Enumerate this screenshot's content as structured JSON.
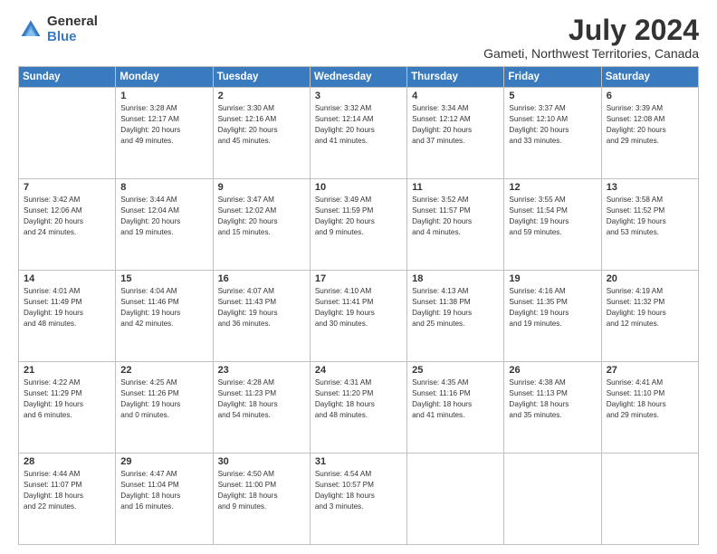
{
  "header": {
    "logo_general": "General",
    "logo_blue": "Blue",
    "month_year": "July 2024",
    "location": "Gameti, Northwest Territories, Canada"
  },
  "days_of_week": [
    "Sunday",
    "Monday",
    "Tuesday",
    "Wednesday",
    "Thursday",
    "Friday",
    "Saturday"
  ],
  "weeks": [
    [
      {
        "day": "",
        "info": ""
      },
      {
        "day": "1",
        "info": "Sunrise: 3:28 AM\nSunset: 12:17 AM\nDaylight: 20 hours\nand 49 minutes."
      },
      {
        "day": "2",
        "info": "Sunrise: 3:30 AM\nSunset: 12:16 AM\nDaylight: 20 hours\nand 45 minutes."
      },
      {
        "day": "3",
        "info": "Sunrise: 3:32 AM\nSunset: 12:14 AM\nDaylight: 20 hours\nand 41 minutes."
      },
      {
        "day": "4",
        "info": "Sunrise: 3:34 AM\nSunset: 12:12 AM\nDaylight: 20 hours\nand 37 minutes."
      },
      {
        "day": "5",
        "info": "Sunrise: 3:37 AM\nSunset: 12:10 AM\nDaylight: 20 hours\nand 33 minutes."
      },
      {
        "day": "6",
        "info": "Sunrise: 3:39 AM\nSunset: 12:08 AM\nDaylight: 20 hours\nand 29 minutes."
      }
    ],
    [
      {
        "day": "7",
        "info": "Sunrise: 3:42 AM\nSunset: 12:06 AM\nDaylight: 20 hours\nand 24 minutes."
      },
      {
        "day": "8",
        "info": "Sunrise: 3:44 AM\nSunset: 12:04 AM\nDaylight: 20 hours\nand 19 minutes."
      },
      {
        "day": "9",
        "info": "Sunrise: 3:47 AM\nSunset: 12:02 AM\nDaylight: 20 hours\nand 15 minutes."
      },
      {
        "day": "10",
        "info": "Sunrise: 3:49 AM\nSunset: 11:59 PM\nDaylight: 20 hours\nand 9 minutes."
      },
      {
        "day": "11",
        "info": "Sunrise: 3:52 AM\nSunset: 11:57 PM\nDaylight: 20 hours\nand 4 minutes."
      },
      {
        "day": "12",
        "info": "Sunrise: 3:55 AM\nSunset: 11:54 PM\nDaylight: 19 hours\nand 59 minutes."
      },
      {
        "day": "13",
        "info": "Sunrise: 3:58 AM\nSunset: 11:52 PM\nDaylight: 19 hours\nand 53 minutes."
      }
    ],
    [
      {
        "day": "14",
        "info": "Sunrise: 4:01 AM\nSunset: 11:49 PM\nDaylight: 19 hours\nand 48 minutes."
      },
      {
        "day": "15",
        "info": "Sunrise: 4:04 AM\nSunset: 11:46 PM\nDaylight: 19 hours\nand 42 minutes."
      },
      {
        "day": "16",
        "info": "Sunrise: 4:07 AM\nSunset: 11:43 PM\nDaylight: 19 hours\nand 36 minutes."
      },
      {
        "day": "17",
        "info": "Sunrise: 4:10 AM\nSunset: 11:41 PM\nDaylight: 19 hours\nand 30 minutes."
      },
      {
        "day": "18",
        "info": "Sunrise: 4:13 AM\nSunset: 11:38 PM\nDaylight: 19 hours\nand 25 minutes."
      },
      {
        "day": "19",
        "info": "Sunrise: 4:16 AM\nSunset: 11:35 PM\nDaylight: 19 hours\nand 19 minutes."
      },
      {
        "day": "20",
        "info": "Sunrise: 4:19 AM\nSunset: 11:32 PM\nDaylight: 19 hours\nand 12 minutes."
      }
    ],
    [
      {
        "day": "21",
        "info": "Sunrise: 4:22 AM\nSunset: 11:29 PM\nDaylight: 19 hours\nand 6 minutes."
      },
      {
        "day": "22",
        "info": "Sunrise: 4:25 AM\nSunset: 11:26 PM\nDaylight: 19 hours\nand 0 minutes."
      },
      {
        "day": "23",
        "info": "Sunrise: 4:28 AM\nSunset: 11:23 PM\nDaylight: 18 hours\nand 54 minutes."
      },
      {
        "day": "24",
        "info": "Sunrise: 4:31 AM\nSunset: 11:20 PM\nDaylight: 18 hours\nand 48 minutes."
      },
      {
        "day": "25",
        "info": "Sunrise: 4:35 AM\nSunset: 11:16 PM\nDaylight: 18 hours\nand 41 minutes."
      },
      {
        "day": "26",
        "info": "Sunrise: 4:38 AM\nSunset: 11:13 PM\nDaylight: 18 hours\nand 35 minutes."
      },
      {
        "day": "27",
        "info": "Sunrise: 4:41 AM\nSunset: 11:10 PM\nDaylight: 18 hours\nand 29 minutes."
      }
    ],
    [
      {
        "day": "28",
        "info": "Sunrise: 4:44 AM\nSunset: 11:07 PM\nDaylight: 18 hours\nand 22 minutes."
      },
      {
        "day": "29",
        "info": "Sunrise: 4:47 AM\nSunset: 11:04 PM\nDaylight: 18 hours\nand 16 minutes."
      },
      {
        "day": "30",
        "info": "Sunrise: 4:50 AM\nSunset: 11:00 PM\nDaylight: 18 hours\nand 9 minutes."
      },
      {
        "day": "31",
        "info": "Sunrise: 4:54 AM\nSunset: 10:57 PM\nDaylight: 18 hours\nand 3 minutes."
      },
      {
        "day": "",
        "info": ""
      },
      {
        "day": "",
        "info": ""
      },
      {
        "day": "",
        "info": ""
      }
    ]
  ]
}
